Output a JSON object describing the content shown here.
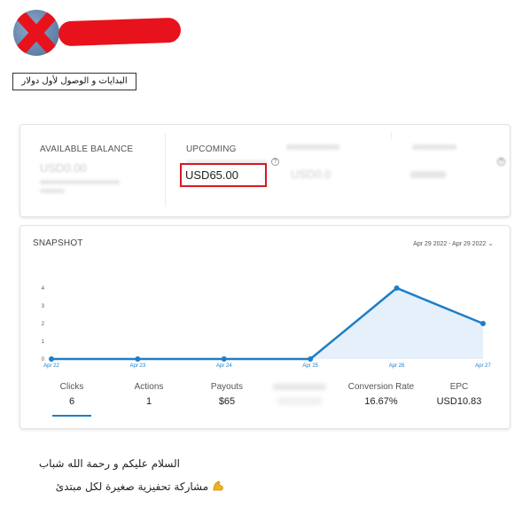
{
  "header": {
    "tag": "البدايات و الوصول لأول دولار"
  },
  "balance": {
    "available": {
      "label": "AVAILABLE BALANCE",
      "value": "USD0.00"
    },
    "upcoming": {
      "label": "UPCOMING",
      "value": "USD65.00"
    },
    "col3": {
      "value": "USD0.0"
    }
  },
  "snapshot": {
    "title": "SNAPSHOT",
    "date_range": "Apr 29 2022 - Apr 29 2022",
    "stats": [
      {
        "label": "Clicks",
        "value": "6"
      },
      {
        "label": "Actions",
        "value": "1"
      },
      {
        "label": "Payouts",
        "value": "$65"
      },
      {
        "label": "Conversion Rate",
        "value": "16.67%"
      },
      {
        "label": "EPC",
        "value": "USD10.83"
      }
    ]
  },
  "chart_data": {
    "type": "area",
    "x": [
      "Apr 22",
      "Apr 23",
      "Apr 24",
      "Apr 25",
      "Apr 26",
      "Apr 27"
    ],
    "series": [
      {
        "values": [
          0,
          0,
          0,
          0,
          4,
          2
        ]
      }
    ],
    "ylim": [
      0,
      4
    ],
    "yticks": [
      "0",
      "1",
      "2",
      "3",
      "4"
    ],
    "grid": false,
    "colors": {
      "line": "#1e7ec8",
      "fill": "#e6f0fa"
    }
  },
  "post": {
    "line1": "السلام عليكم و رحمة الله شباب",
    "line2": "مشاركة تحفيزية صغيرة لكل مبتدئ"
  },
  "colors": {
    "accent": "#1e7ec8",
    "highlight": "#d9181f"
  },
  "icons": {
    "help": "?",
    "chevron": "⌄"
  }
}
